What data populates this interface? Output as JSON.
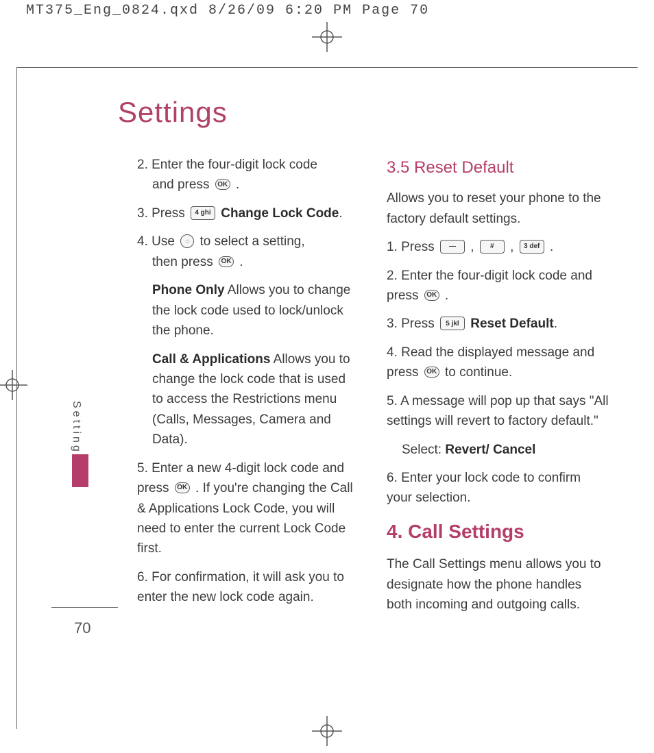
{
  "printHeader": "MT375_Eng_0824.qxd  8/26/09  6:20 PM  Page 70",
  "pageTitle": "Settings",
  "sideTab": "Settings",
  "pageNumber": "70",
  "keys": {
    "ok": "OK",
    "four": "4 ghi",
    "five": "5 jkl",
    "three": "3 def",
    "hash": "#",
    "dash": "—",
    "nav": "◌"
  },
  "left": {
    "s2a": "2. Enter the four-digit lock code",
    "s2b": "and press ",
    "s2c": " .",
    "s3a": "3. Press  ",
    "s3b": "Change Lock Code",
    "s3c": ".",
    "s4a": "4. Use  ",
    "s4b": " to select a setting,",
    "s4c": "then press  ",
    "s4d": " .",
    "po_t": "Phone Only",
    "po_r": " Allows you to change the lock code used to lock/unlock the phone.",
    "ca_t": "Call & Applications",
    "ca_r": " Allows you to change the lock code that is used to access the Restrictions menu (Calls, Messages, Camera and Data).",
    "s5a": "5. Enter a new 4-digit lock code and press  ",
    "s5b": " . If you're changing the Call & Applications Lock Code, you will need to enter the current Lock Code first.",
    "s6": "6. For confirmation, it will ask you to enter the new lock code again."
  },
  "right": {
    "h35": "3.5 Reset Default",
    "intro": "Allows you to reset your phone to the factory default settings.",
    "r1a": "1. Press  ",
    "r1b": " ,  ",
    "r1c": " ,  ",
    "r1d": " .",
    "r2a": "2. Enter the four-digit lock code and press  ",
    "r2b": " .",
    "r3a": "3. Press  ",
    "r3b": "Reset Default",
    "r3c": ".",
    "r4a": "4. Read the displayed message and press  ",
    "r4b": "  to continue.",
    "r5": "5. A message will pop up that says \"All settings will revert to factory default.\"",
    "r5sel_a": "Select: ",
    "r5sel_b": "Revert/ Cancel",
    "r6": "6. Enter your lock code to confirm your selection.",
    "h4": "4. Call Settings",
    "h4body": "The Call Settings menu allows you to designate how the phone handles both incoming and outgoing calls."
  }
}
